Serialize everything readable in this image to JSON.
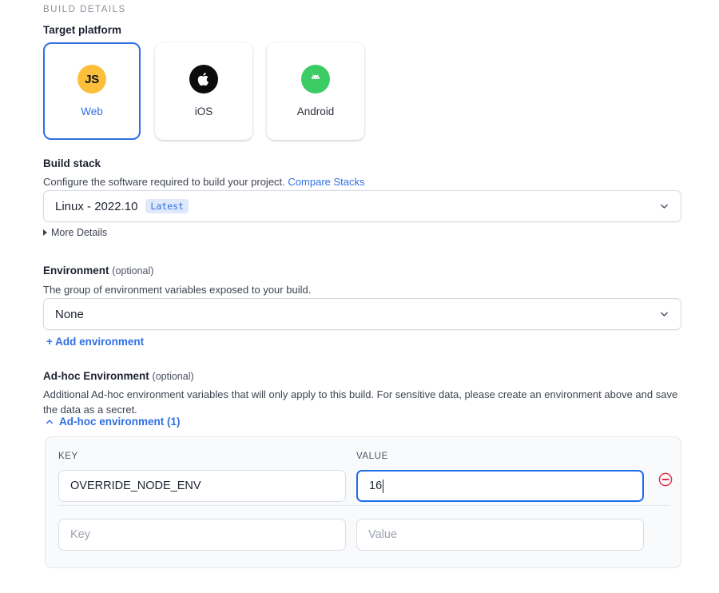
{
  "section": {
    "eyebrow": "BUILD DETAILS"
  },
  "target_platform": {
    "label": "Target platform",
    "options": [
      {
        "name": "Web",
        "icon": "js-icon",
        "icon_text": "JS",
        "selected": true
      },
      {
        "name": "iOS",
        "icon": "apple-icon",
        "selected": false
      },
      {
        "name": "Android",
        "icon": "android-icon",
        "selected": false
      }
    ]
  },
  "build_stack": {
    "label": "Build stack",
    "helper": "Configure the software required to build your project.",
    "link_label": "Compare Stacks",
    "selected_value": "Linux - 2022.10",
    "badge": "Latest",
    "more_details_label": "More Details"
  },
  "environment": {
    "label": "Environment",
    "optional": "(optional)",
    "helper": "The group of environment variables exposed to your build.",
    "selected_value": "None",
    "add_label": "+ Add environment"
  },
  "adhoc_environment": {
    "label": "Ad-hoc Environment",
    "optional": "(optional)",
    "helper": "Additional Ad-hoc environment variables that will only apply to this build. For sensitive data, please create an environment above and save the data as a secret.",
    "toggle_label": "Ad-hoc environment (1)",
    "columns": {
      "key": "KEY",
      "value": "VALUE"
    },
    "rows": [
      {
        "key": "OVERRIDE_NODE_ENV",
        "value": "16",
        "value_focused": true
      }
    ],
    "new_row": {
      "key_placeholder": "Key",
      "value_placeholder": "Value"
    },
    "remove_icon": "remove-circle-icon"
  },
  "colors": {
    "accent": "#2f6fe4",
    "focus_border": "#1f6feb",
    "danger": "#e0304a",
    "js_yellow": "#fbbf3c",
    "android_green": "#3ccb64",
    "badge_bg": "#dfe9fb",
    "panel_bg": "#f9fafc"
  }
}
